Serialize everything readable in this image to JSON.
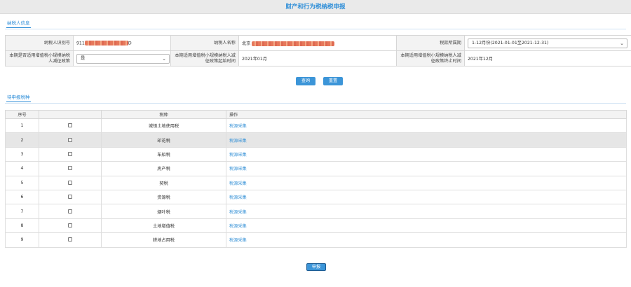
{
  "page": {
    "title": "财产和行为税纳税申报"
  },
  "taxpayer_section": {
    "tab_label": "纳税人信息"
  },
  "form": {
    "taxpayer_id_label": "纳税人识别号",
    "taxpayer_id_value": "911",
    "taxpayer_id_value_tail": "D",
    "taxpayer_name_label": "纳税人名称",
    "taxpayer_name_value": "北京",
    "period_label": "税款所属期",
    "period_value": "1-12月份(2021-01-01至2021-12-31)",
    "small_scale_label": "本期是否适用增值税小规模纳税人减征政策",
    "small_scale_value": "是",
    "start_label": "本期适用增值税小规模纳税人减征政策起始时间",
    "start_value": "2021年01月",
    "end_label": "本期适用增值税小规模纳税人减征政策终止时间",
    "end_value": "2021年12月"
  },
  "actions": {
    "query_label": "查询",
    "reset_label": "重置",
    "submit_label": "申报"
  },
  "tax_section": {
    "tab_label": "待申报税种"
  },
  "table": {
    "headers": {
      "seq": "序号",
      "select": "",
      "tax_type": "税种",
      "operation": "操作"
    },
    "rows": [
      {
        "seq": "1",
        "tax_type": "城镇土地使用税",
        "action": "税源采集"
      },
      {
        "seq": "2",
        "tax_type": "印花税",
        "action": "税源采集"
      },
      {
        "seq": "3",
        "tax_type": "车船税",
        "action": "税源采集"
      },
      {
        "seq": "4",
        "tax_type": "房产税",
        "action": "税源采集"
      },
      {
        "seq": "5",
        "tax_type": "契税",
        "action": "税源采集"
      },
      {
        "seq": "6",
        "tax_type": "资源税",
        "action": "税源采集"
      },
      {
        "seq": "7",
        "tax_type": "烟叶税",
        "action": "税源采集"
      },
      {
        "seq": "8",
        "tax_type": "土地增值税",
        "action": "税源采集"
      },
      {
        "seq": "9",
        "tax_type": "耕地占用税",
        "action": "税源采集"
      }
    ]
  },
  "colors": {
    "accent": "#3c95d8",
    "title_bg": "#eaeaea",
    "highlight_row": "#e6e6e6"
  },
  "icons": {
    "select_chevron": "chevron-down-icon",
    "row_checkbox": "checkbox-icon"
  }
}
